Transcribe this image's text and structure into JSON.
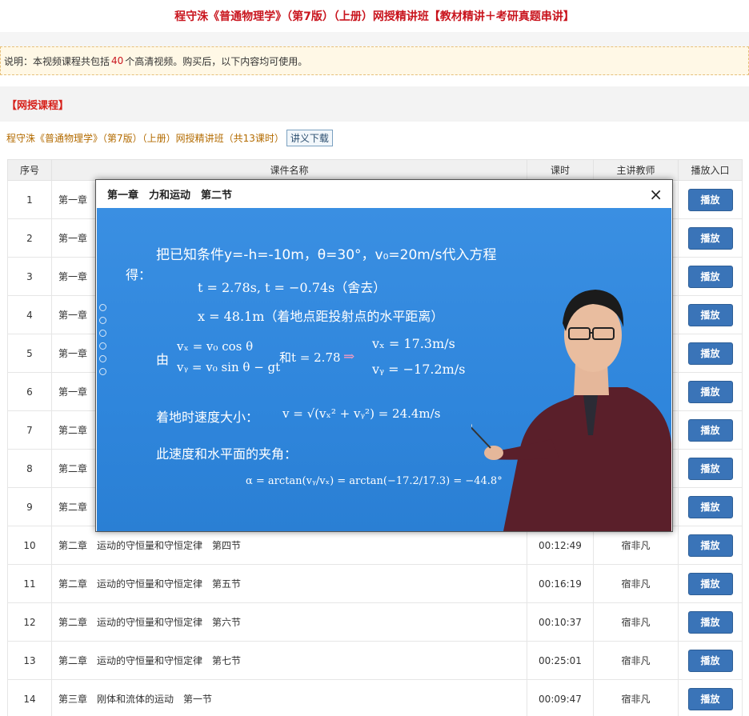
{
  "page": {
    "title": "程守洙《普通物理学》（第7版）（上册）网授精讲班【教材精讲＋考研真题串讲】",
    "notice_prefix": "说明：本视频课程共包括",
    "notice_count": "40",
    "notice_suffix": "个高清视频。购买后，以下内容均可使用。",
    "section_title": "【网授课程】",
    "course_line": "程守洙《普通物理学》（第7版）（上册）网授精讲班（共13课时）",
    "download_label": "讲义下载"
  },
  "table": {
    "headers": [
      "序号",
      "课件名称",
      "课时",
      "主讲教师",
      "播放入口"
    ],
    "play_label": "播放",
    "rows": [
      {
        "num": "1",
        "name": "第一章",
        "dur": "",
        "teacher": ""
      },
      {
        "num": "2",
        "name": "第一章",
        "dur": "",
        "teacher": ""
      },
      {
        "num": "3",
        "name": "第一章",
        "dur": "",
        "teacher": ""
      },
      {
        "num": "4",
        "name": "第一章",
        "dur": "",
        "teacher": ""
      },
      {
        "num": "5",
        "name": "第一章",
        "dur": "",
        "teacher": ""
      },
      {
        "num": "6",
        "name": "第一章",
        "dur": "",
        "teacher": ""
      },
      {
        "num": "7",
        "name": "第二章",
        "dur": "",
        "teacher": ""
      },
      {
        "num": "8",
        "name": "第二章",
        "dur": "",
        "teacher": ""
      },
      {
        "num": "9",
        "name": "第二章",
        "dur": "",
        "teacher": ""
      },
      {
        "num": "10",
        "name": "第二章　运动的守恒量和守恒定律　第四节",
        "dur": "00:12:49",
        "teacher": "宿非凡"
      },
      {
        "num": "11",
        "name": "第二章　运动的守恒量和守恒定律　第五节",
        "dur": "00:16:19",
        "teacher": "宿非凡"
      },
      {
        "num": "12",
        "name": "第二章　运动的守恒量和守恒定律　第六节",
        "dur": "00:10:37",
        "teacher": "宿非凡"
      },
      {
        "num": "13",
        "name": "第二章　运动的守恒量和守恒定律　第七节",
        "dur": "00:25:01",
        "teacher": "宿非凡"
      },
      {
        "num": "14",
        "name": "第三章　刚体和流体的运动　第一节",
        "dur": "00:09:47",
        "teacher": "宿非凡"
      }
    ]
  },
  "modal": {
    "title": "第一章　力和运动　第二节",
    "close_symbol": "×",
    "video": {
      "line1": "把已知条件y=-h=-10m，θ=30°，v₀=20m/s代入方程",
      "line1b": "得：",
      "line2": "t = 2.78s, t = −0.74s（舍去）",
      "line3": "x = 48.1m（着地点距投射点的水平距离）",
      "eq_you": "由",
      "eq_a1": "vₓ = v₀ cos θ",
      "eq_a2": "vᵧ = v₀ sin θ − gt",
      "eq_and": "和t = 2.78",
      "eq_arrow": "⇒",
      "eq_b1": "vₓ = 17.3m/s",
      "eq_b2": "vᵧ = −17.2m/s",
      "speed_label": "着地时速度大小：",
      "speed_eq": "v = √(vₓ² + vᵧ²) = 24.4m/s",
      "angle_label": "此速度和水平面的夹角：",
      "angle_eq": "α = arctan(vᵧ/vₓ) = arctan(−17.2/17.3) = −44.8°"
    }
  }
}
